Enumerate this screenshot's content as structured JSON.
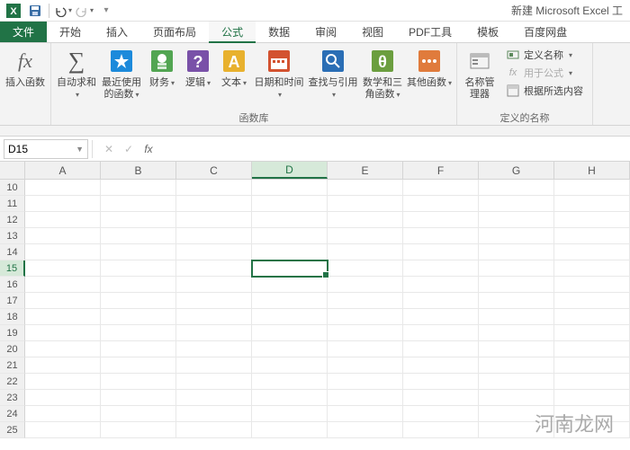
{
  "title": "新建 Microsoft Excel 工",
  "tabs": {
    "file": "文件",
    "items": [
      "开始",
      "插入",
      "页面布局",
      "公式",
      "数据",
      "审阅",
      "视图",
      "PDF工具",
      "模板",
      "百度网盘"
    ],
    "active_index": 3
  },
  "ribbon": {
    "insert_fn": "插入函数",
    "autosum": "自动求和",
    "recent": "最近使用的函数",
    "financial": "财务",
    "logical": "逻辑",
    "text": "文本",
    "datetime": "日期和时间",
    "lookup": "查找与引用",
    "math": "数学和三角函数",
    "more": "其他函数",
    "funclib_label": "函数库",
    "name_mgr": "名称管理器",
    "define_name": "定义名称",
    "use_in_formula": "用于公式",
    "create_from_sel": "根据所选内容",
    "names_label": "定义的名称"
  },
  "namebox": "D15",
  "columns": [
    "A",
    "B",
    "C",
    "D",
    "E",
    "F",
    "G",
    "H"
  ],
  "row_start": 10,
  "row_end": 25,
  "selected": {
    "col": "D",
    "row": 15
  },
  "watermark": "河南龙网"
}
